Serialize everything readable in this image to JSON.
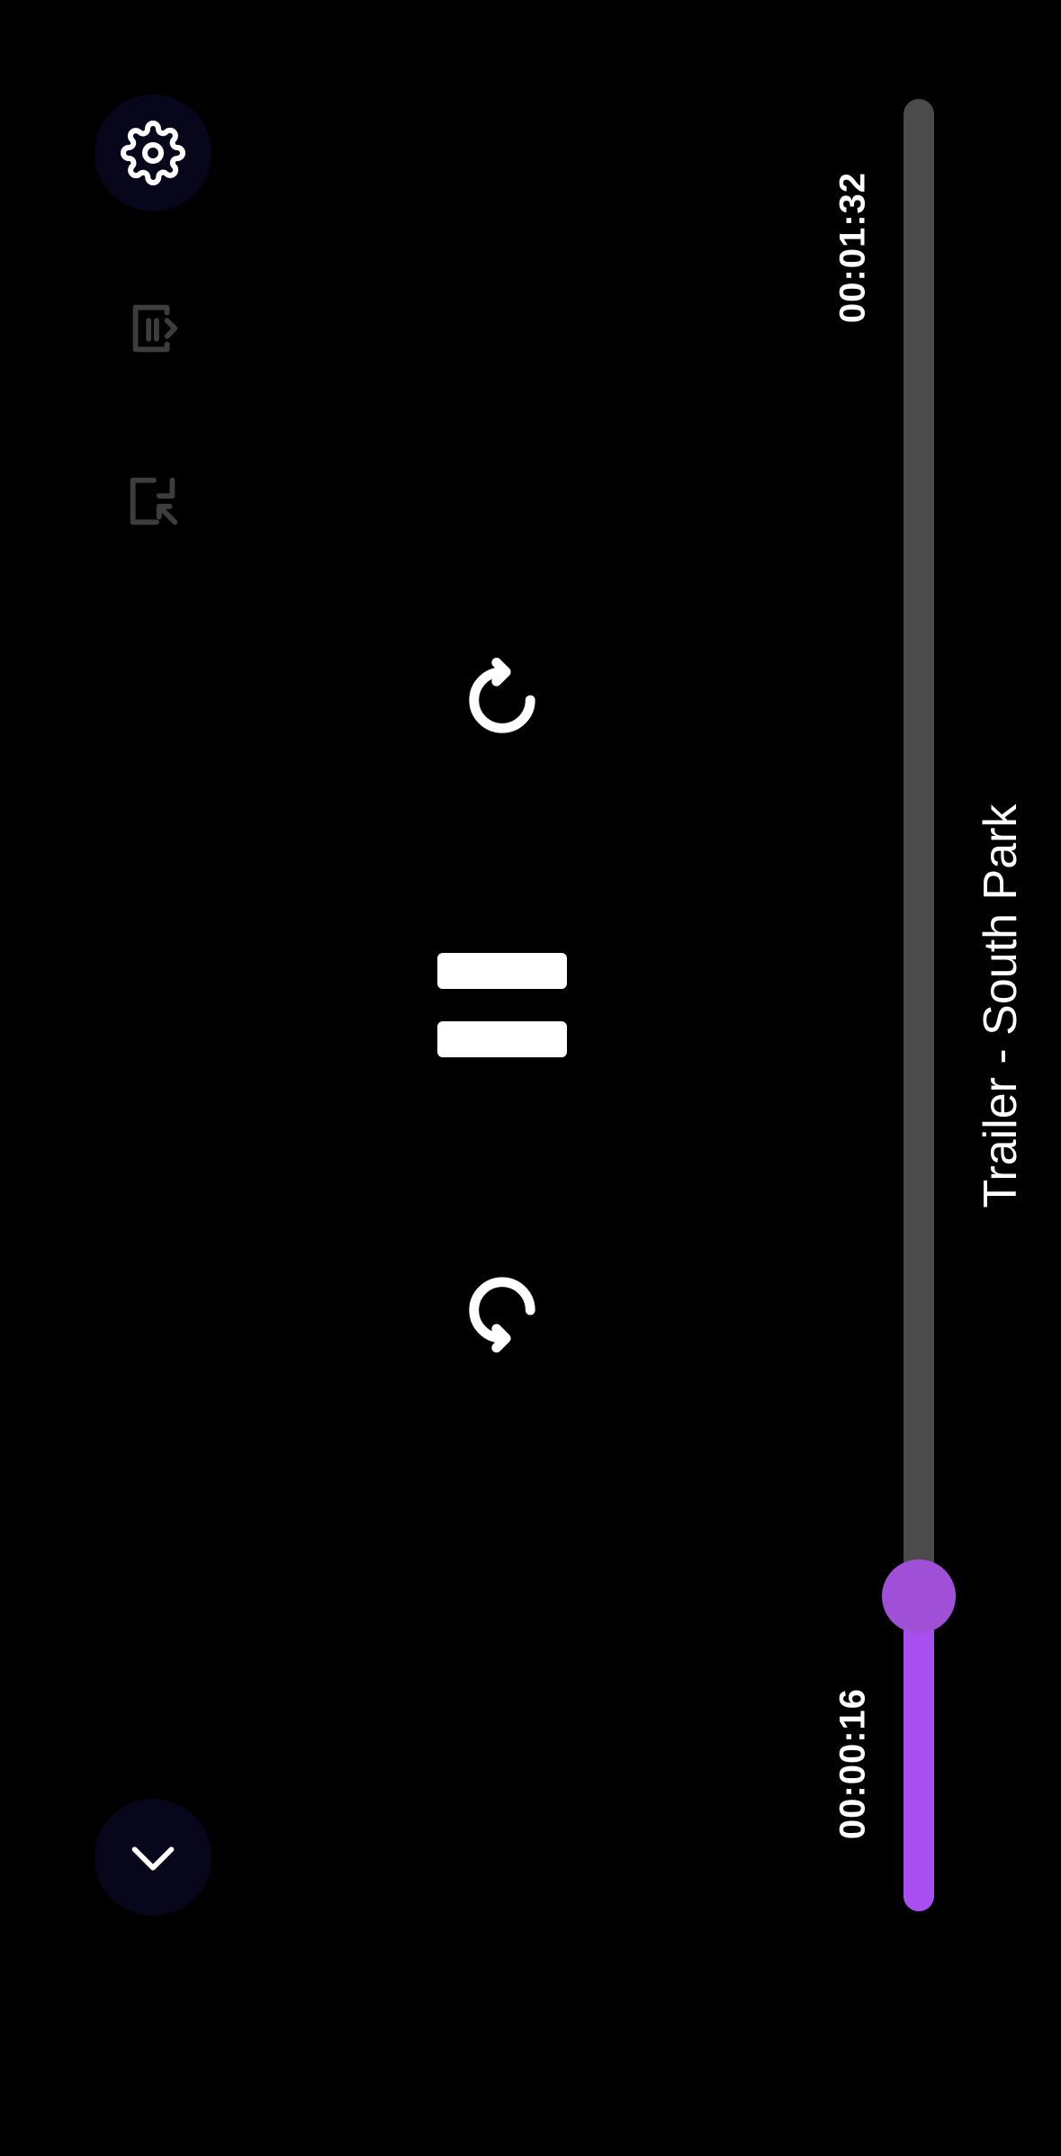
{
  "player": {
    "title": "Trailer - South Park",
    "duration": "00:01:32",
    "position": "00:00:16",
    "progress_fraction": 0.174,
    "accent_color": "#a94ff2",
    "track_color": "#4b4b4b"
  },
  "toolbar": {
    "settings_icon": "gear-icon",
    "playlist_icon": "playlist-icon",
    "exit_pip_icon": "picture-in-picture-exit-icon",
    "collapse_icon": "chevron-down-icon"
  },
  "controls": {
    "replay_icon": "rotate-back-icon",
    "pause_icon": "pause-icon",
    "forward_icon": "rotate-forward-icon"
  }
}
